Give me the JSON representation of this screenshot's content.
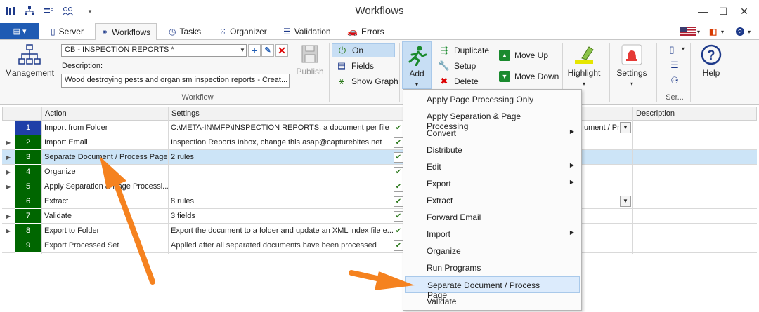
{
  "window": {
    "title": "Workflows"
  },
  "tabs": [
    {
      "label": "Server"
    },
    {
      "label": "Workflows"
    },
    {
      "label": "Tasks"
    },
    {
      "label": "Organizer"
    },
    {
      "label": "Validation"
    },
    {
      "label": "Errors"
    }
  ],
  "ribbon": {
    "management_label": "Management",
    "workflow_combo_value": "CB - INSPECTION REPORTS *",
    "description_label": "Description:",
    "description_value": "Wood destroying pests and organism inspection reports - Creat...",
    "workflow_group_label": "Workflow",
    "publish_label": "Publish",
    "on_label": "On",
    "fields_label": "Fields",
    "show_graph_label": "Show Graph",
    "add_label": "Add",
    "duplicate_label": "Duplicate",
    "setup_label": "Setup",
    "delete_label": "Delete",
    "move_up_label": "Move Up",
    "move_down_label": "Move Down",
    "highlight_label": "Highlight",
    "settings_label": "Settings",
    "ser_label": "Ser...",
    "help_label": "Help"
  },
  "grid": {
    "columns": [
      "Action",
      "Settings",
      "Description"
    ],
    "rows": [
      {
        "num": "1",
        "action": "Import from Folder",
        "settings": "C:\\META-IN\\MFP\\INSPECTION REPORTS, a document per file"
      },
      {
        "num": "2",
        "action": "Import Email",
        "settings": "Inspection Reports Inbox, change.this.asap@capturebites.net"
      },
      {
        "num": "3",
        "action": "Separate Document / Process Page",
        "settings": "2 rules"
      },
      {
        "num": "4",
        "action": "Organize",
        "settings": ""
      },
      {
        "num": "5",
        "action": "Apply Separation & Page Processi...",
        "settings": ""
      },
      {
        "num": "6",
        "action": "Extract",
        "settings": "8 rules"
      },
      {
        "num": "7",
        "action": "Validate",
        "settings": "3 fields"
      },
      {
        "num": "8",
        "action": "Export to Folder",
        "settings": "Export the document to a folder and update an XML index file e..."
      },
      {
        "num": "9",
        "action": "Export Processed Set",
        "settings": "Applied after all separated documents have been processed"
      }
    ],
    "row2_hidden_value": "ument / Pr..."
  },
  "menu": {
    "items": [
      {
        "label": "Apply Page Processing Only"
      },
      {
        "label": "Apply Separation & Page Processing"
      },
      {
        "label": "Convert"
      },
      {
        "label": "Distribute"
      },
      {
        "label": "Edit"
      },
      {
        "label": "Export"
      },
      {
        "label": "Extract"
      },
      {
        "label": "Forward Email"
      },
      {
        "label": "Import"
      },
      {
        "label": "Organize"
      },
      {
        "label": "Run Programs"
      },
      {
        "label": "Separate Document / Process Page"
      },
      {
        "label": "Validate"
      }
    ]
  },
  "colors": {
    "row_number_green": "#006600",
    "row_number_blue": "#1f3fa8",
    "selection": "#cce4f7",
    "menu_highlight": "#dcebfc",
    "arrow_orange": "#f5821f"
  }
}
